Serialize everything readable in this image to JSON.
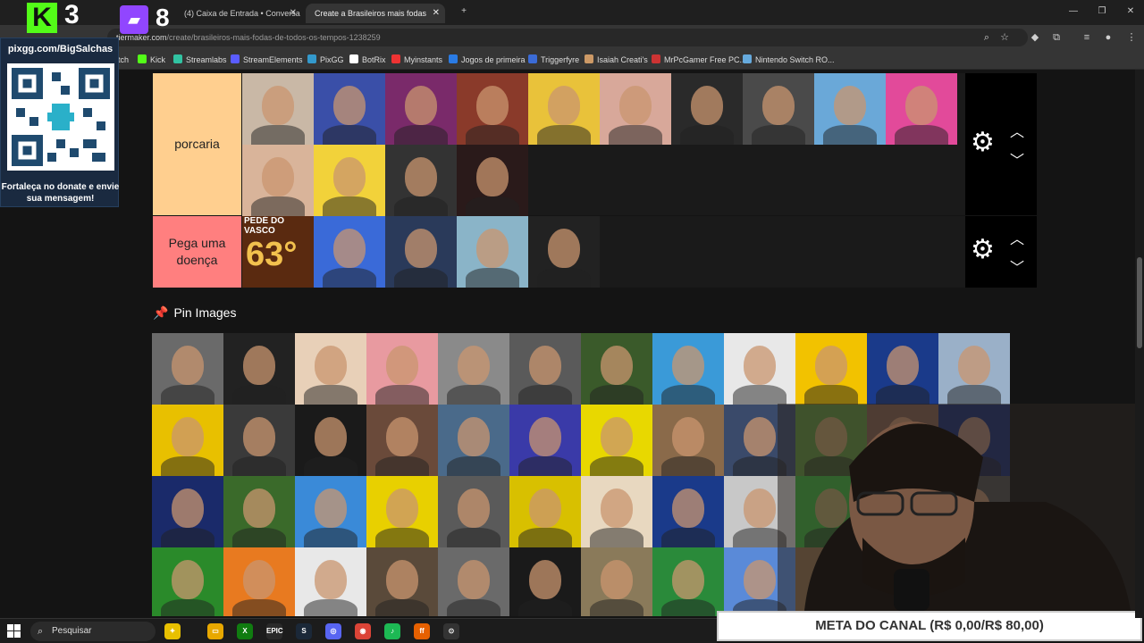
{
  "browser": {
    "tabs": [
      {
        "label": "(4) Caixa de Entrada • Conversa"
      },
      {
        "label": "Create a Brasileiros mais fodas"
      }
    ],
    "url_host": "tiermaker.com",
    "url_path": "/create/brasileiros-mais-fodas-de-todos-os-tempos-1238259",
    "bookmarks": [
      {
        "label": "tch",
        "color": "#9146ff"
      },
      {
        "label": "Kick",
        "color": "#53fc18"
      },
      {
        "label": "Streamlabs",
        "color": "#31c3a2"
      },
      {
        "label": "StreamElements",
        "color": "#5a5cff"
      },
      {
        "label": "PixGG",
        "color": "#39c"
      },
      {
        "label": "BotRix",
        "color": "#fff"
      },
      {
        "label": "Myinstants",
        "color": "#e33"
      },
      {
        "label": "Jogos de primeira",
        "color": "#2a7be4"
      },
      {
        "label": "Triggerfyre",
        "color": "#3b6bd6"
      },
      {
        "label": "Isaiah Creati's",
        "color": "#c96"
      },
      {
        "label": "MrPcGamer Free PC...",
        "color": "#c33"
      },
      {
        "label": "Nintendo Switch RO...",
        "color": "#6ad"
      }
    ]
  },
  "overlay": {
    "kick_logo": "K",
    "kick_count": "3",
    "twitch_count": "8",
    "pix_title": "pixgg.com/BigSalchas",
    "pix_message": "Fortaleça no donate e envie sua mensagem!",
    "goal": "META DO CANAL (R$ 0,00/R$ 80,00)"
  },
  "tiers": [
    {
      "label": "porcaria",
      "color": "#ffcf8f",
      "items": [
        "#c9b8a6",
        "#3a4fa8",
        "#7a2a6a",
        "#8a3a2a",
        "#e9c23a",
        "#d8a89a",
        "#2a2a2a",
        "#4a4a4a",
        "#6aa8d8",
        "#e24a9a",
        "#d9b49a",
        "#f2d23a",
        "#333333",
        "#2a1a1a"
      ]
    },
    {
      "label": "Pega uma doença",
      "color": "#ff7f7f",
      "items": [
        "#5a2a10",
        "#3a6ad8",
        "#2a3a5a",
        "#8ab4c8",
        "#222222"
      ],
      "first_text": "PEDÉ DO VASCO",
      "first_big": "63°"
    }
  ],
  "pin": {
    "pin_icon": "pushpin-icon",
    "title": "Pin Images"
  },
  "pool": [
    "#6a6a6a",
    "#222222",
    "#e8d0b8",
    "#e89aa0",
    "#8a8a8a",
    "#5a5a5a",
    "#3a5a2a",
    "#3a9ad8",
    "#e8e8e8",
    "#f2c200",
    "#1a3a8a",
    "#9ab0c8",
    "#e8c000",
    "#3a3a3a",
    "#1a1a1a",
    "#6a4a3a",
    "#4a6a8a",
    "#3a3aa8",
    "#e8d800",
    "#8a6a4a",
    "#3a4a6a",
    "#5a8a3a",
    "#7a5a4a",
    "#1a2a6a",
    "#1a2a6a",
    "#3a6a2a",
    "#3a8ad8",
    "#e8d000",
    "#5a5a5a",
    "#d8c000",
    "#e8d8c0",
    "#1a3a8a",
    "#c8c8c8",
    "#3aa83a",
    "#6a4a3a",
    "#4a4a4a",
    "#2a8a2a",
    "#e87a20",
    "#e8e8e8",
    "#5a4a3a",
    "#6a6a6a",
    "#1a1a1a",
    "#8a7a5a",
    "#2a8a3a",
    "#5a8ad8",
    "#8a6a4a",
    "#4a4a4a",
    "#3a3a3a"
  ],
  "taskbar": {
    "search_placeholder": "Pesquisar",
    "apps": [
      {
        "label": "✦",
        "color": "#e8c000"
      },
      {
        "label": "▭",
        "color": "#e8a800"
      },
      {
        "label": "X",
        "color": "#107c10"
      },
      {
        "label": "EPIC",
        "color": "#2a2a2a"
      },
      {
        "label": "S",
        "color": "#1b2838"
      },
      {
        "label": "◎",
        "color": "#5865f2"
      },
      {
        "label": "◉",
        "color": "#db4437"
      },
      {
        "label": "♪",
        "color": "#1db954"
      },
      {
        "label": "ff",
        "color": "#e66000"
      },
      {
        "label": "⊙",
        "color": "#333"
      }
    ]
  }
}
